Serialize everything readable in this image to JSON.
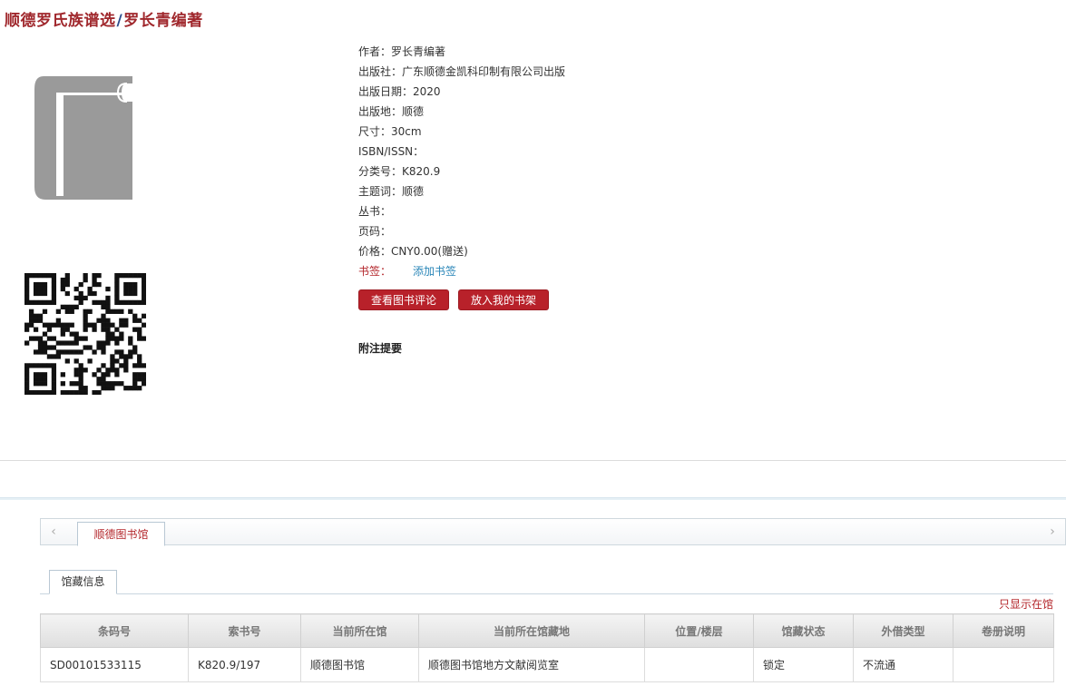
{
  "title": {
    "main": "顺德罗氏族谱选",
    "separator": "/",
    "author": "罗长青编著"
  },
  "icons": {
    "cover": "book-icon",
    "qr": "qr-code-icon",
    "prev": "chevron-left-icon",
    "next": "chevron-right-icon"
  },
  "meta": [
    {
      "label": "作者：",
      "value": "罗长青编著"
    },
    {
      "label": "出版社：",
      "value": "广东顺德金凯科印制有限公司出版"
    },
    {
      "label": "出版日期：",
      "value": "2020"
    },
    {
      "label": "出版地：",
      "value": "顺德"
    },
    {
      "label": "尺寸：",
      "value": "30cm"
    },
    {
      "label": "ISBN/ISSN：",
      "value": ""
    },
    {
      "label": "分类号：",
      "value": "K820.9"
    },
    {
      "label": "主题词：",
      "value": "顺德"
    },
    {
      "label": "丛书：",
      "value": ""
    },
    {
      "label": "页码：",
      "value": ""
    },
    {
      "label": "价格：",
      "value": "CNY0.00(赠送)"
    }
  ],
  "bookmark": {
    "label": "书签：",
    "link": "添加书签"
  },
  "buttons": {
    "reviews": "查看图书评论",
    "shelf": "放入我的书架"
  },
  "notes_heading": "附注提要",
  "library_tab": "顺德图书馆",
  "holdings_tab": "馆藏信息",
  "only_available": "只显示在馆",
  "table": {
    "headers": [
      "条码号",
      "索书号",
      "当前所在馆",
      "当前所在馆藏地",
      "位置/楼层",
      "馆藏状态",
      "外借类型",
      "卷册说明"
    ],
    "rows": [
      [
        "SD00101533115",
        "K820.9/197",
        "顺德图书馆",
        "顺德图书馆地方文献阅览室",
        "",
        "锁定",
        "不流通",
        ""
      ]
    ]
  },
  "colors": {
    "accent": "#b8212a",
    "link": "#2a86b8",
    "title": "#a0282d"
  }
}
